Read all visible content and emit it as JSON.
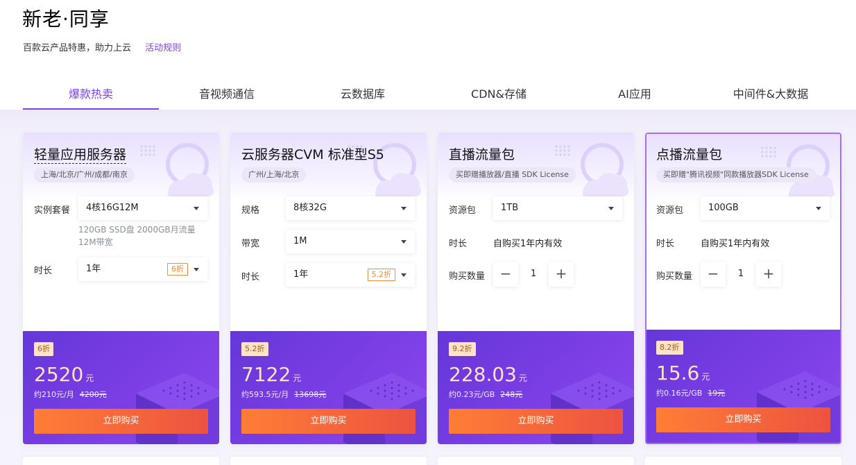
{
  "header": {
    "title": "新老·同享",
    "subtitle": "百款云产品特惠，助力上云",
    "rules_link": "活动规则"
  },
  "tabs": [
    {
      "label": "爆款热卖",
      "active": true
    },
    {
      "label": "音视频通信",
      "active": false
    },
    {
      "label": "云数据库",
      "active": false
    },
    {
      "label": "CDN&存储",
      "active": false
    },
    {
      "label": "AI应用",
      "active": false
    },
    {
      "label": "中间件&大数据",
      "active": false
    }
  ],
  "colors": {
    "accent": "#7a3ff0",
    "buy_start": "#ff7d36",
    "buy_end": "#ec5340",
    "price": "#ffe2c2"
  },
  "cards": [
    {
      "title": "轻量应用服务器",
      "regions": "上海/北京/广州/成都/南京",
      "package_label": "实例套餐",
      "package_value": "4核16G12M",
      "package_hint": "120GB SSD盘 2000GB月流量 12M带宽",
      "duration_label": "时长",
      "duration_value": "1年",
      "duration_badge": "6折",
      "discount": "6折",
      "price": "2520",
      "price_unit": "元",
      "monthly": "约210元/月",
      "original": "4200元",
      "buy_label": "立即购买"
    },
    {
      "title": "云服务器CVM 标准型S5",
      "regions": "广州/上海/北京",
      "spec_label": "规格",
      "spec_value": "8核32G",
      "bandwidth_label": "带宽",
      "bandwidth_value": "1M",
      "duration_label": "时长",
      "duration_value": "1年",
      "duration_badge": "5.2折",
      "discount": "5.2折",
      "price": "7122",
      "price_unit": "元",
      "monthly": "约593.5元/月",
      "original": "13698元",
      "buy_label": "立即购买"
    },
    {
      "title": "直播流量包",
      "gift": "买即赠播放器/直播 SDK License",
      "resource_label": "资源包",
      "resource_value": "1TB",
      "duration_label": "时长",
      "duration_value": "自购买1年内有效",
      "qty_label": "购买数量",
      "qty_value": "1",
      "minus": "−",
      "plus": "+",
      "discount": "9.2折",
      "price": "228.03",
      "price_unit": "元",
      "monthly": "约0.23元/GB",
      "original": "248元",
      "buy_label": "立即购买"
    },
    {
      "title": "点播流量包",
      "gift": "买即赠\"腾讯视频\"同款播放器SDK License",
      "resource_label": "资源包",
      "resource_value": "100GB",
      "duration_label": "时长",
      "duration_value": "自购买1年内有效",
      "qty_label": "购买数量",
      "qty_value": "1",
      "minus": "−",
      "plus": "+",
      "discount": "8.2折",
      "price": "15.6",
      "price_unit": "元",
      "monthly": "约0.16元/GB",
      "original": "19元",
      "buy_label": "立即购买"
    }
  ]
}
